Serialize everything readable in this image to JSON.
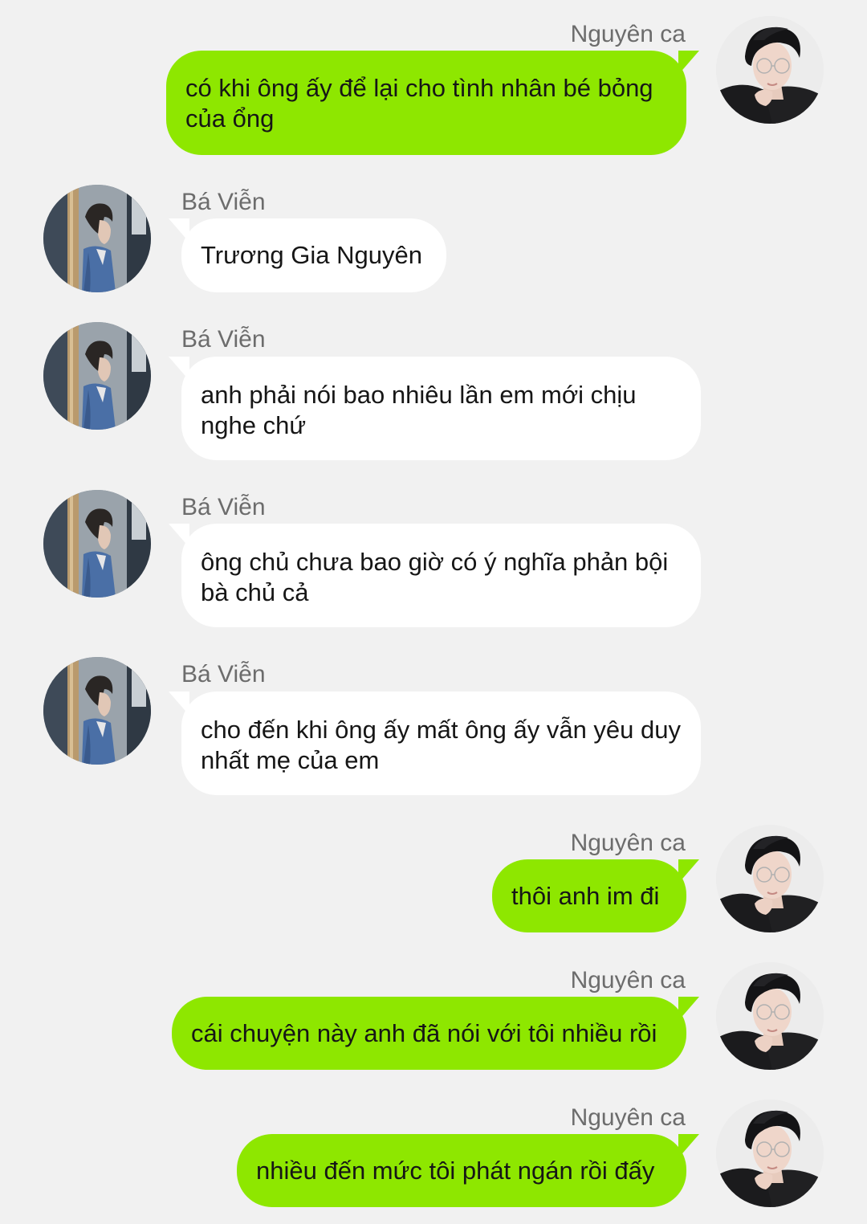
{
  "messages": [
    {
      "sender": "Nguyên ca",
      "side": "out",
      "text": "có khi ông ấy để lại cho tình nhân bé bỏng của ổng"
    },
    {
      "sender": "Bá Viễn",
      "side": "in",
      "text": "Trương Gia Nguyên"
    },
    {
      "sender": "Bá Viễn",
      "side": "in",
      "text": "anh phải nói bao nhiêu lần em mới chịu nghe chứ"
    },
    {
      "sender": "Bá Viễn",
      "side": "in",
      "text": "ông chủ chưa bao giờ có ý nghĩa phản bội bà chủ cả"
    },
    {
      "sender": "Bá Viễn",
      "side": "in",
      "text": "cho đến khi ông ấy mất ông ấy vẫn yêu duy nhất mẹ của em"
    },
    {
      "sender": "Nguyên ca",
      "side": "out",
      "text": "thôi anh im đi"
    },
    {
      "sender": "Nguyên ca",
      "side": "out",
      "text": "cái chuyện này anh đã nói với tôi nhiều rồi"
    },
    {
      "sender": "Nguyên ca",
      "side": "out",
      "text": "nhiều đến mức tôi phát ngán rồi đấy"
    }
  ],
  "colors": {
    "background": "#f1f1f1",
    "outgoing_bubble": "#8ee700",
    "incoming_bubble": "#ffffff",
    "sender_name": "#6c6c6c",
    "text": "#161616"
  },
  "icons": {
    "outgoing_avatar": "avatar-nguyen-ca",
    "incoming_avatar": "avatar-ba-vien"
  }
}
